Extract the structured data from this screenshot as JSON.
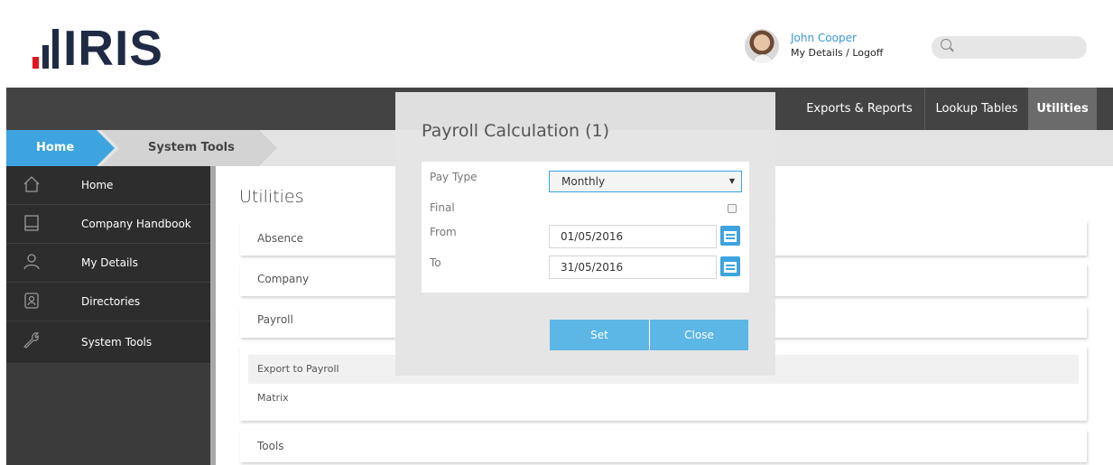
{
  "header": {
    "logo_text": "IRIS",
    "user_name": "John Cooper",
    "my_details": "My Details",
    "separator": "/",
    "logoff": "Logoff",
    "search_placeholder": ""
  },
  "navbar": {
    "items": [
      {
        "label": "Exports & Reports"
      },
      {
        "label": "Lookup Tables"
      },
      {
        "label": "Utilities"
      }
    ]
  },
  "breadcrumb": {
    "home": "Home",
    "current": "System Tools"
  },
  "sidebar": {
    "items": [
      {
        "label": "Home",
        "icon": "house-icon"
      },
      {
        "label": "Company Handbook",
        "icon": "book-icon"
      },
      {
        "label": "My Details",
        "icon": "person-icon"
      },
      {
        "label": "Directories",
        "icon": "contact-card-icon"
      },
      {
        "label": "System Tools",
        "icon": "wrench-icon"
      }
    ]
  },
  "main": {
    "title": "Utilities",
    "cards": [
      {
        "label": "Absence"
      },
      {
        "label": "Company"
      },
      {
        "label": "Payroll"
      },
      {
        "label": "Tools"
      }
    ],
    "payroll_submenu": [
      {
        "label": "Export to Payroll"
      },
      {
        "label": "Matrix"
      }
    ]
  },
  "modal": {
    "title": "Payroll Calculation (1)",
    "pay_type_label": "Pay Type",
    "pay_type_value": "Monthly",
    "final_label": "Final",
    "from_label": "From",
    "from_value": "01/05/2016",
    "to_label": "To",
    "to_value": "31/05/2016",
    "set_label": "Set",
    "close_label": "Close"
  },
  "colors": {
    "accent": "#3ea4e0",
    "nav_bg": "#434343",
    "sidebar_bg": "#2d2d2d",
    "logo_dark": "#1f2b44",
    "logo_red": "#e2141c"
  }
}
